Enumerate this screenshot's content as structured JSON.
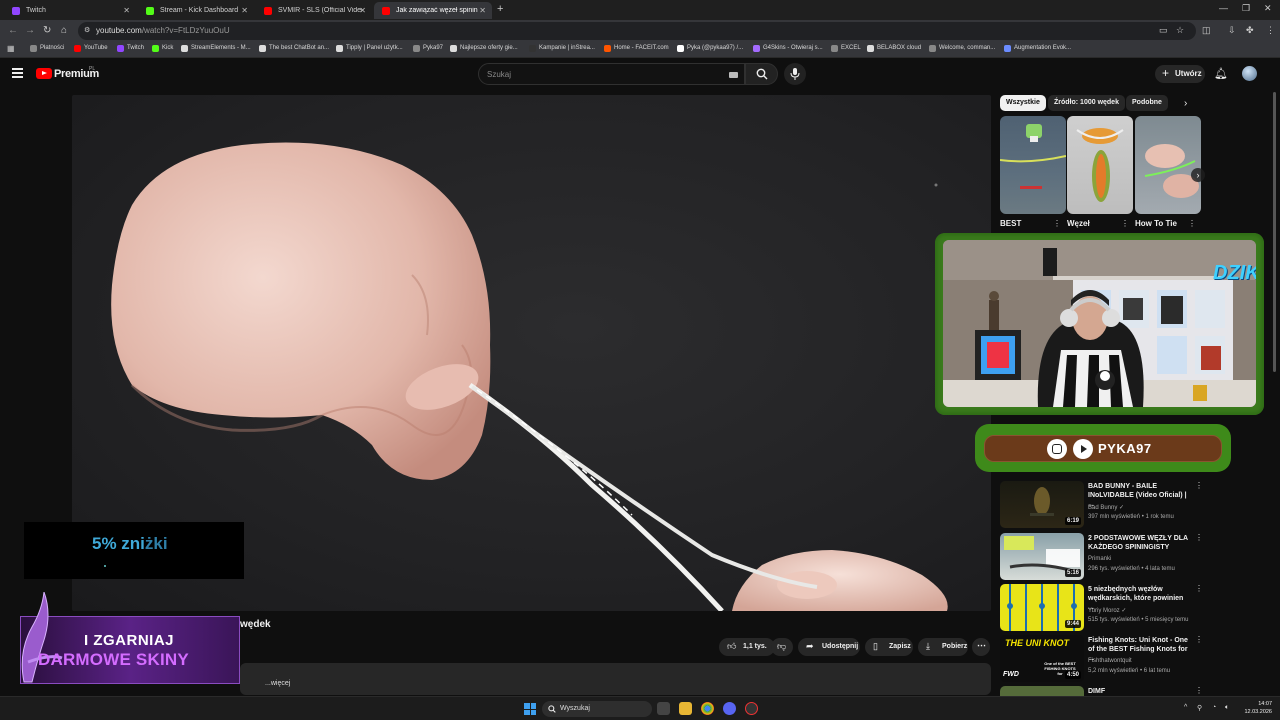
{
  "browser": {
    "tabs": [
      {
        "label": "Twitch",
        "favicon_color": "#9146ff",
        "active": false
      },
      {
        "label": "Stream - Kick Dashboard",
        "favicon_color": "#53fc18",
        "active": false
      },
      {
        "label": "SVMIR - SLS (Official Video) - Y",
        "favicon_color": "#ff0000",
        "active": false
      },
      {
        "label": "Jak zawiązać węzeł spiningowy",
        "favicon_color": "#ff0000",
        "active": true
      }
    ],
    "new_tab": "+",
    "url_host": "youtube.com",
    "url_path": "/watch?v=FtLDzYuuOuU",
    "bookmarks": [
      {
        "label": "Płatności",
        "color": "#888"
      },
      {
        "label": "YouTube",
        "color": "#ff0000"
      },
      {
        "label": "Twitch",
        "color": "#9146ff"
      },
      {
        "label": "Kick",
        "color": "#53fc18"
      },
      {
        "label": "StreamElements - M...",
        "color": "#ddd"
      },
      {
        "label": "The best ChatBot an...",
        "color": "#ddd"
      },
      {
        "label": "Tipply | Panel użytk...",
        "color": "#ddd"
      },
      {
        "label": "Pyka97",
        "color": "#888"
      },
      {
        "label": "Najlepsze oferty gie...",
        "color": "#ddd"
      },
      {
        "label": "Kampanie | inStrea...",
        "color": "#333"
      },
      {
        "label": "Home - FACEIT.com",
        "color": "#ff5500"
      },
      {
        "label": "Pyka (@pykaa97) /...",
        "color": "#fff"
      },
      {
        "label": "G4Skins - Otwieraj s...",
        "color": "#a46bff"
      },
      {
        "label": "EXCEL",
        "color": "#888"
      },
      {
        "label": "BELABOX cloud",
        "color": "#ddd"
      },
      {
        "label": "Welcome, comman...",
        "color": "#888"
      },
      {
        "label": "Augmentation Evok...",
        "color": "#6b8cff"
      }
    ]
  },
  "youtube": {
    "brand": "Premium",
    "region": "PL",
    "search_placeholder": "Szukaj",
    "create_label": "Utwórz",
    "video_title_visible": "wędek",
    "actions": {
      "likes": "1,1 tys.",
      "share": "Udostępnij",
      "save": "Zapisz",
      "download": "Pobierz"
    },
    "description_more": "...więcej",
    "chips": [
      "Wszystkie",
      "Źródło: 1000 wędek",
      "Podobne"
    ],
    "shorts": [
      {
        "title": "BEST"
      },
      {
        "title": "Węzeł"
      },
      {
        "title": "How To Tie"
      }
    ],
    "recommendations": [
      {
        "title": "BAD BUNNY - BAILE INoLVIDABLE (Video Oficial) | ...",
        "channel": "Bad Bunny",
        "meta": "397 mln wyświetleń • 1 rok temu",
        "duration": "6:19",
        "verified": true
      },
      {
        "title": "2 PODSTAWOWE WĘZŁY DLA KAŻDEGO SPININGISTY",
        "channel": "Primanki",
        "meta": "296 tys. wyświetleń • 4 lata temu",
        "duration": "5:16",
        "verified": false
      },
      {
        "title": "5 niezbędnych węzłów wędkarskich, które powinien ...",
        "channel": "Yuriy Moroz",
        "meta": "515 tys. wyświetleń • 5 miesięcy temu",
        "duration": "9:44",
        "verified": true
      },
      {
        "title": "Fishing Knots: Uni Knot - One of the BEST Fishing Knots for ...",
        "channel": "Fishthatwontquit",
        "meta": "5,2 mln wyświetleń • 6 lat temu",
        "duration": "4:50",
        "verified": false
      },
      {
        "title": "DIMF",
        "channel": "",
        "meta": "",
        "duration": "",
        "verified": false
      }
    ]
  },
  "overlays": {
    "promo_bold": "5% zni",
    "promo_rest": "żki",
    "skins_line1": "I ZGARNIAJ",
    "skins_line2": "DARMOWE SKINY",
    "webcam_logo": "DZIK",
    "streamer_handle": "PYKA97",
    "uni_knot_thumb_text": "THE UNI KNOT",
    "uni_knot_sub": "One of the BEST FISHING KNOTS for",
    "fwd_text": "FWD"
  },
  "taskbar": {
    "search_placeholder": "Wyszukaj",
    "time": "14:07",
    "date": "12.03.2026"
  }
}
